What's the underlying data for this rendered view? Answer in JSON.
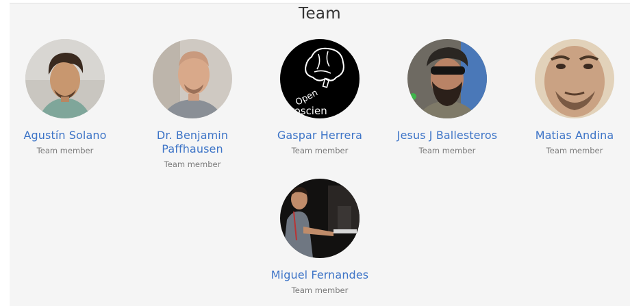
{
  "section": {
    "title": "Team"
  },
  "members": [
    {
      "name": "Agustín Solano",
      "role": "Team member",
      "avatar": "person-photo-icon"
    },
    {
      "name": "Dr. Benjamin Paffhausen",
      "role": "Team member",
      "avatar": "person-photo-icon"
    },
    {
      "name": "Gaspar Herrera",
      "role": "Team member",
      "avatar": "open-neuroscience-logo-icon",
      "logo_text_top": "Open",
      "logo_text_bottom": "euroscien"
    },
    {
      "name": "Jesus J Ballesteros",
      "role": "Team member",
      "avatar": "person-photo-icon"
    },
    {
      "name": "Matias Andina",
      "role": "Team member",
      "avatar": "person-photo-icon"
    },
    {
      "name": "Miguel Fernandes",
      "role": "Team member",
      "avatar": "person-photo-icon"
    }
  ]
}
